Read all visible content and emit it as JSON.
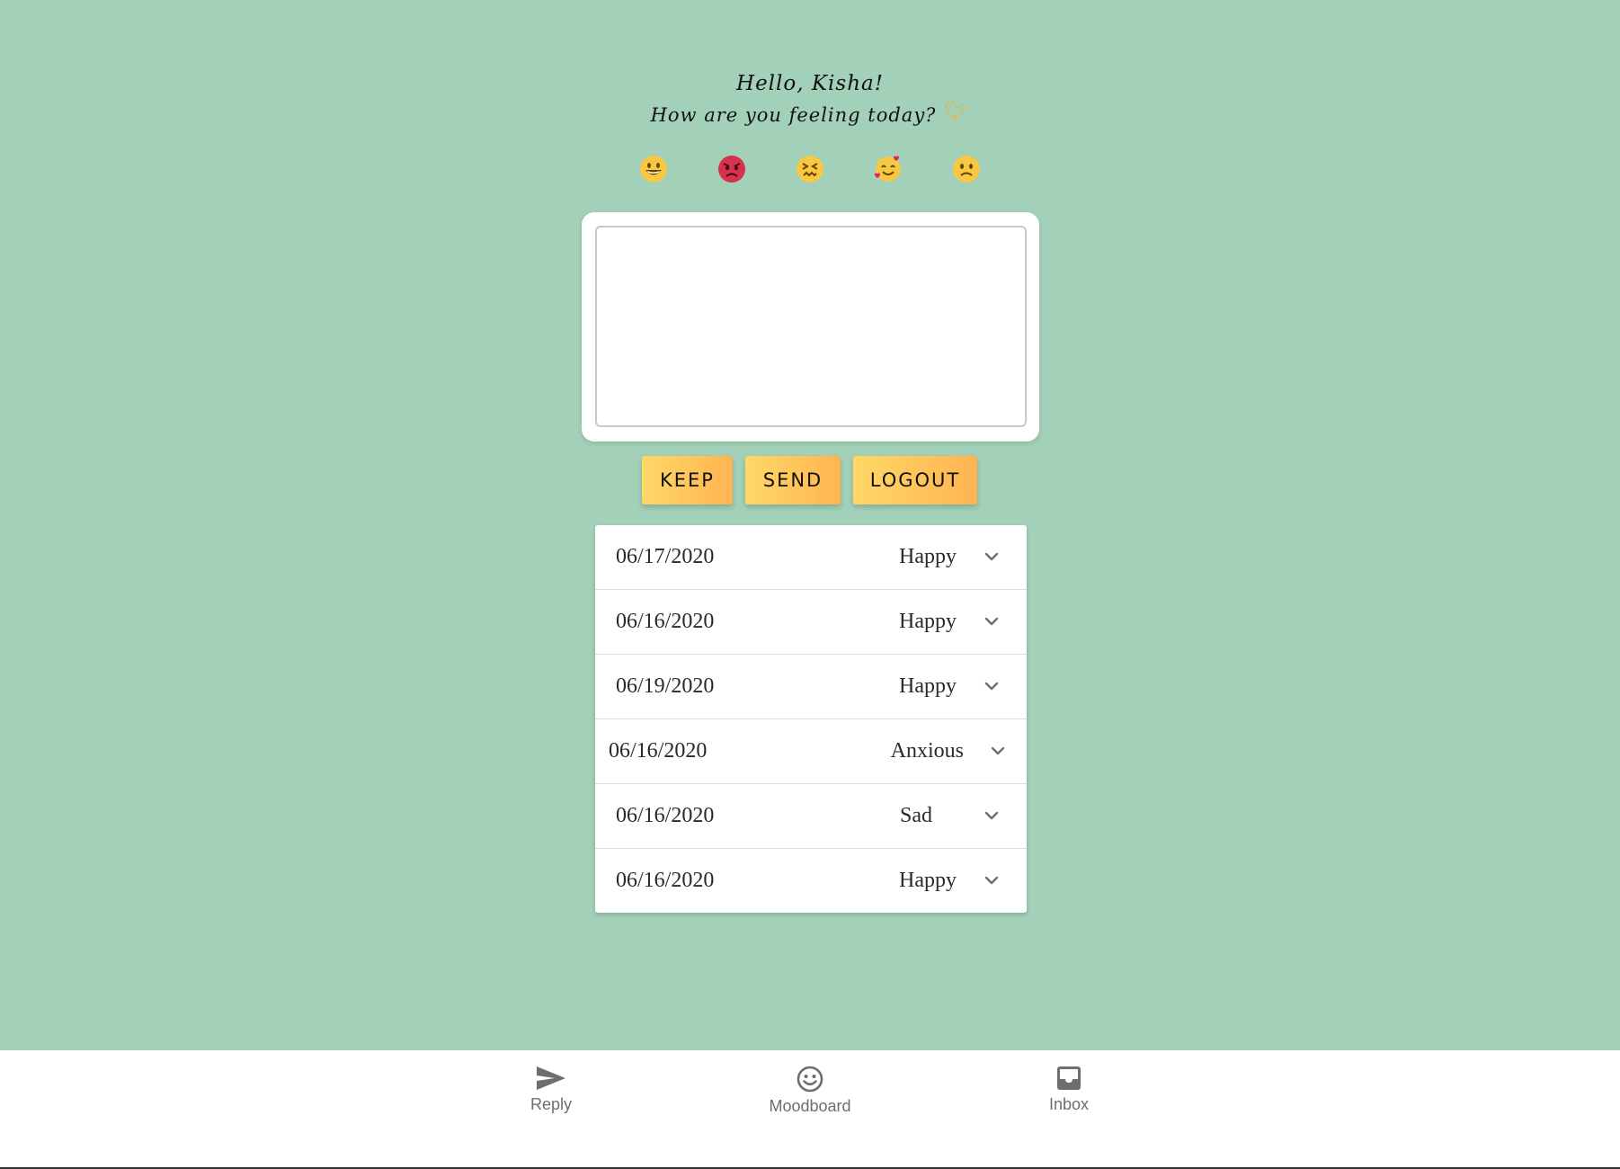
{
  "greeting": {
    "hello": "Hello, Kisha!",
    "question": "How are you feeling today?",
    "bird_icon": "bird-icon"
  },
  "moods": [
    {
      "icon": "grinning-face-icon",
      "color": "#f7c843"
    },
    {
      "icon": "angry-face-icon",
      "color": "#d8314c"
    },
    {
      "icon": "confounded-face-icon",
      "color": "#f7c843"
    },
    {
      "icon": "smiling-face-with-hearts-icon",
      "color": "#f7c843"
    },
    {
      "icon": "slightly-frowning-face-icon",
      "color": "#f7c843"
    }
  ],
  "journal": {
    "value": "",
    "placeholder": ""
  },
  "buttons": {
    "keep": "KEEP",
    "send": "SEND",
    "logout": "LOGOUT"
  },
  "entries": [
    {
      "date": "06/17/2020",
      "mood": "Happy"
    },
    {
      "date": "06/16/2020",
      "mood": "Happy"
    },
    {
      "date": "06/19/2020",
      "mood": "Happy"
    },
    {
      "date": "06/16/2020",
      "mood": "Anxious"
    },
    {
      "date": "06/16/2020",
      "mood": "Sad"
    },
    {
      "date": "06/16/2020",
      "mood": "Happy"
    }
  ],
  "nav": {
    "reply": "Reply",
    "moodboard": "Moodboard",
    "inbox": "Inbox"
  },
  "colors": {
    "background": "#a2d0b8",
    "button_gradient_start": "#ffd866",
    "button_gradient_end": "#ffb451",
    "nav_icon": "#6e6e6e"
  }
}
